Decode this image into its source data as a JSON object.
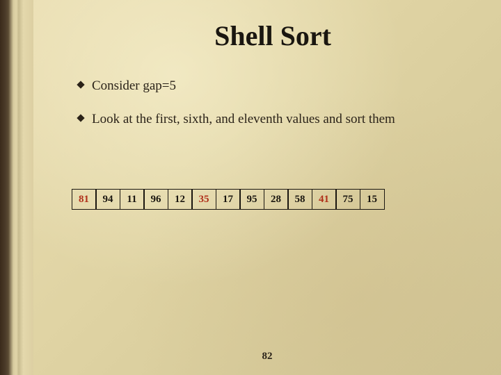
{
  "title": "Shell Sort",
  "bullets": [
    "Consider gap=5",
    "Look at the first, sixth, and eleventh values and sort them"
  ],
  "array": [
    {
      "v": "81",
      "hl": true
    },
    {
      "v": "94",
      "hl": false
    },
    {
      "v": "11",
      "hl": false
    },
    {
      "v": "96",
      "hl": false
    },
    {
      "v": "12",
      "hl": false
    },
    {
      "v": "35",
      "hl": true
    },
    {
      "v": "17",
      "hl": false
    },
    {
      "v": "95",
      "hl": false
    },
    {
      "v": "28",
      "hl": false
    },
    {
      "v": "58",
      "hl": false
    },
    {
      "v": "41",
      "hl": true
    },
    {
      "v": "75",
      "hl": false
    },
    {
      "v": "15",
      "hl": false
    }
  ],
  "page_number": "82",
  "colors": {
    "highlight": "#b0301a",
    "text": "#1a1610",
    "page_bg": "#e0d4a4"
  }
}
